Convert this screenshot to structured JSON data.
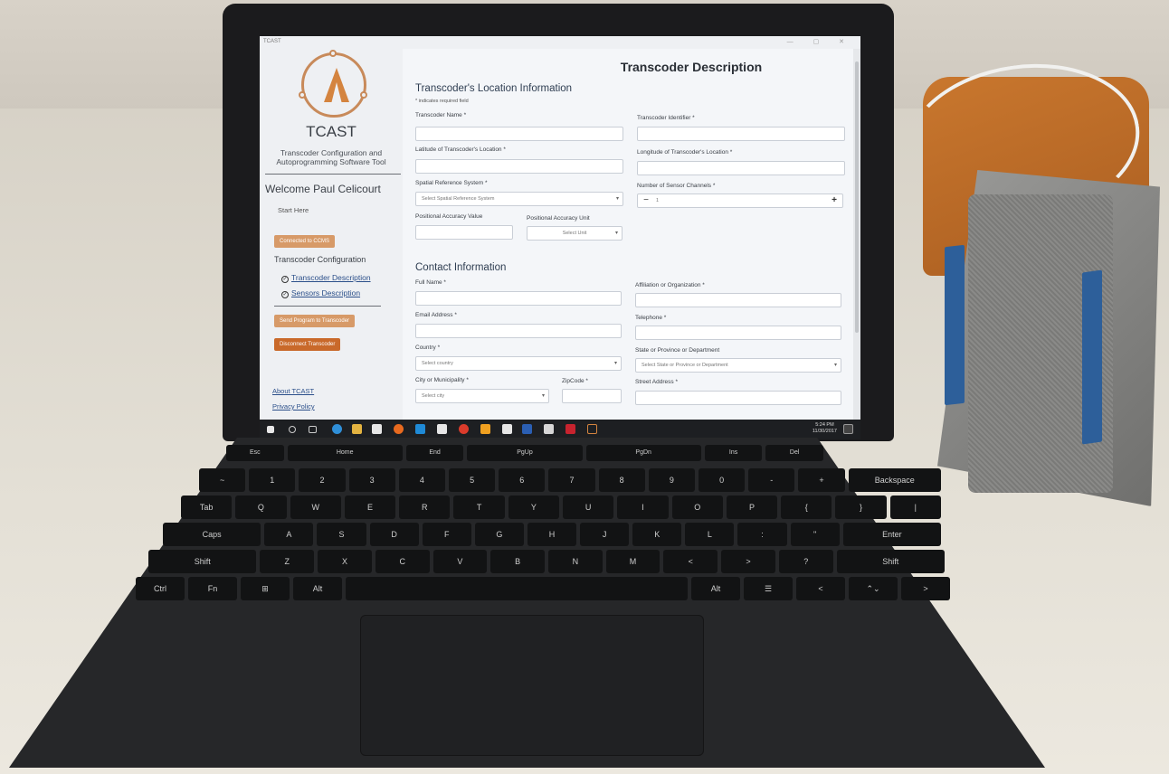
{
  "app": {
    "title_bar": "TCAST",
    "brand": "TCAST",
    "brand_sub": "Transcoder Configuration and Autoprogramming Software Tool",
    "welcome": "Welcome Paul Celicourt",
    "start_here": "Start Here",
    "connected_button": "Connected to CCMS",
    "config_section": "Transcoder Configuration",
    "nav": [
      "Transcoder Description",
      "Sensors Description"
    ],
    "send_button": "Send Program to Transcoder",
    "disconnect_button": "Disconnect Transcoder",
    "footer_links": [
      "About TCAST",
      "Privacy Policy"
    ],
    "accent": "#d4843f"
  },
  "form": {
    "page_title": "Transcoder Description",
    "location_title": "Transcoder's Location Information",
    "required_note": "* indicates required field",
    "labels": {
      "name": "Transcoder Name *",
      "identifier": "Transcoder Identifier *",
      "latitude": "Latitude of Transcoder's Location *",
      "longitude": "Longitude of Transcoder's Location *",
      "spatial": "Spatial Reference System *",
      "sensor_channels": "Number of Sensor Channels *",
      "pos_accuracy": "Positional Accuracy Value",
      "pos_unit": "Positional Accuracy Unit"
    },
    "placeholders": {
      "spatial": "Select Spatial Reference System",
      "unit": "Select Unit",
      "channels": "1"
    },
    "stepper_minus": "−",
    "stepper_plus": "+",
    "contact_title": "Contact Information",
    "contact_labels": {
      "full_name": "Full Name *",
      "affiliation": "Affiliation or Organization *",
      "email": "Email Address *",
      "telephone": "Telephone *",
      "country": "Country *",
      "state": "State or Province or Department",
      "city": "City or Municipality *",
      "zip": "ZipCode *",
      "street": "Street Address *"
    },
    "contact_placeholders": {
      "country": "Select country",
      "state": "Select State or Province or Department",
      "city": "Select city"
    }
  },
  "taskbar": {
    "time": "5:24 PM",
    "date": "11/30/2017"
  },
  "keyboard": {
    "row_fn": [
      "Esc",
      "Home",
      "End",
      "PgUp",
      "PgDn",
      "Ins",
      "Del"
    ],
    "row1": [
      "~",
      "1",
      "2",
      "3",
      "4",
      "5",
      "6",
      "7",
      "8",
      "9",
      "0",
      "-",
      "+",
      "Backspace"
    ],
    "row2": [
      "Tab",
      "Q",
      "W",
      "E",
      "R",
      "T",
      "Y",
      "U",
      "I",
      "O",
      "P",
      "{",
      "}",
      "|"
    ],
    "row3": [
      "Caps",
      "A",
      "S",
      "D",
      "F",
      "G",
      "H",
      "J",
      "K",
      "L",
      ":",
      "\"",
      "Enter"
    ],
    "row4": [
      "Shift",
      "Z",
      "X",
      "C",
      "V",
      "B",
      "N",
      "M",
      "<",
      ">",
      "?",
      "Shift"
    ],
    "row5": [
      "Ctrl",
      "Fn",
      "⊞",
      "Alt",
      "",
      "Alt",
      "☰",
      "<",
      "⌃⌄",
      ">"
    ]
  }
}
